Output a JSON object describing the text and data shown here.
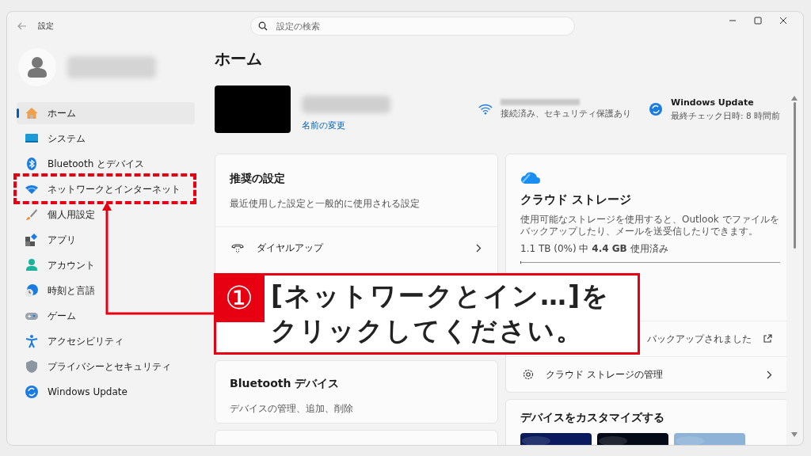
{
  "window": {
    "title": "設定",
    "search_placeholder": "設定の検索"
  },
  "sidebar": {
    "items": [
      {
        "label": "ホーム",
        "kind": "home",
        "selected": true
      },
      {
        "label": "システム",
        "kind": "system",
        "selected": false
      },
      {
        "label": "Bluetooth とデバイス",
        "kind": "bluetooth",
        "selected": false
      },
      {
        "label": "ネットワークとインターネット",
        "kind": "network",
        "selected": false
      },
      {
        "label": "個人用設定",
        "kind": "brush",
        "selected": false
      },
      {
        "label": "アプリ",
        "kind": "apps",
        "selected": false
      },
      {
        "label": "アカウント",
        "kind": "account",
        "selected": false
      },
      {
        "label": "時刻と言語",
        "kind": "time",
        "selected": false
      },
      {
        "label": "ゲーム",
        "kind": "game",
        "selected": false
      },
      {
        "label": "アクセシビリティ",
        "kind": "accessibility",
        "selected": false
      },
      {
        "label": "プライバシーとセキュリティ",
        "kind": "shield",
        "selected": false
      },
      {
        "label": "Windows Update",
        "kind": "update",
        "selected": false
      }
    ]
  },
  "page_title": "ホーム",
  "profile": {
    "rename_link": "名前の変更"
  },
  "status": [
    {
      "kind": "wifi",
      "subtitle": "接続済み、セキュリティ保護あり"
    },
    {
      "kind": "update",
      "title": "Windows Update",
      "subtitle": "最終チェック日時: 8 時間前"
    }
  ],
  "recommended": {
    "title": "推奨の設定",
    "subtitle": "最近使用した設定と一般的に使用される設定",
    "items": [
      {
        "label": "ダイヤルアップ"
      }
    ]
  },
  "bluetooth_card": {
    "title": "Bluetooth デバイス",
    "subtitle": "デバイスの管理、追加、削除"
  },
  "cloud_card": {
    "title": "クラウド ストレージ",
    "description": "使用可能なストレージを使用すると、Outlook でファイルをバックアップしたり、メールを送受信したりできます。",
    "usage": "1.1 TB (0%) 中 **4.4 GB** 使用済み",
    "level": 0.004,
    "rows": [
      {
        "kind": "status",
        "value": "バックアップされました"
      },
      {
        "kind": "link",
        "label": "クラウド ストレージの管理"
      }
    ]
  },
  "customize_card": {
    "title": "デバイスをカスタマイズする"
  },
  "annotation": {
    "number": "①",
    "lines": [
      "[ネットワークとイン…]を",
      "クリックしてください。"
    ]
  }
}
